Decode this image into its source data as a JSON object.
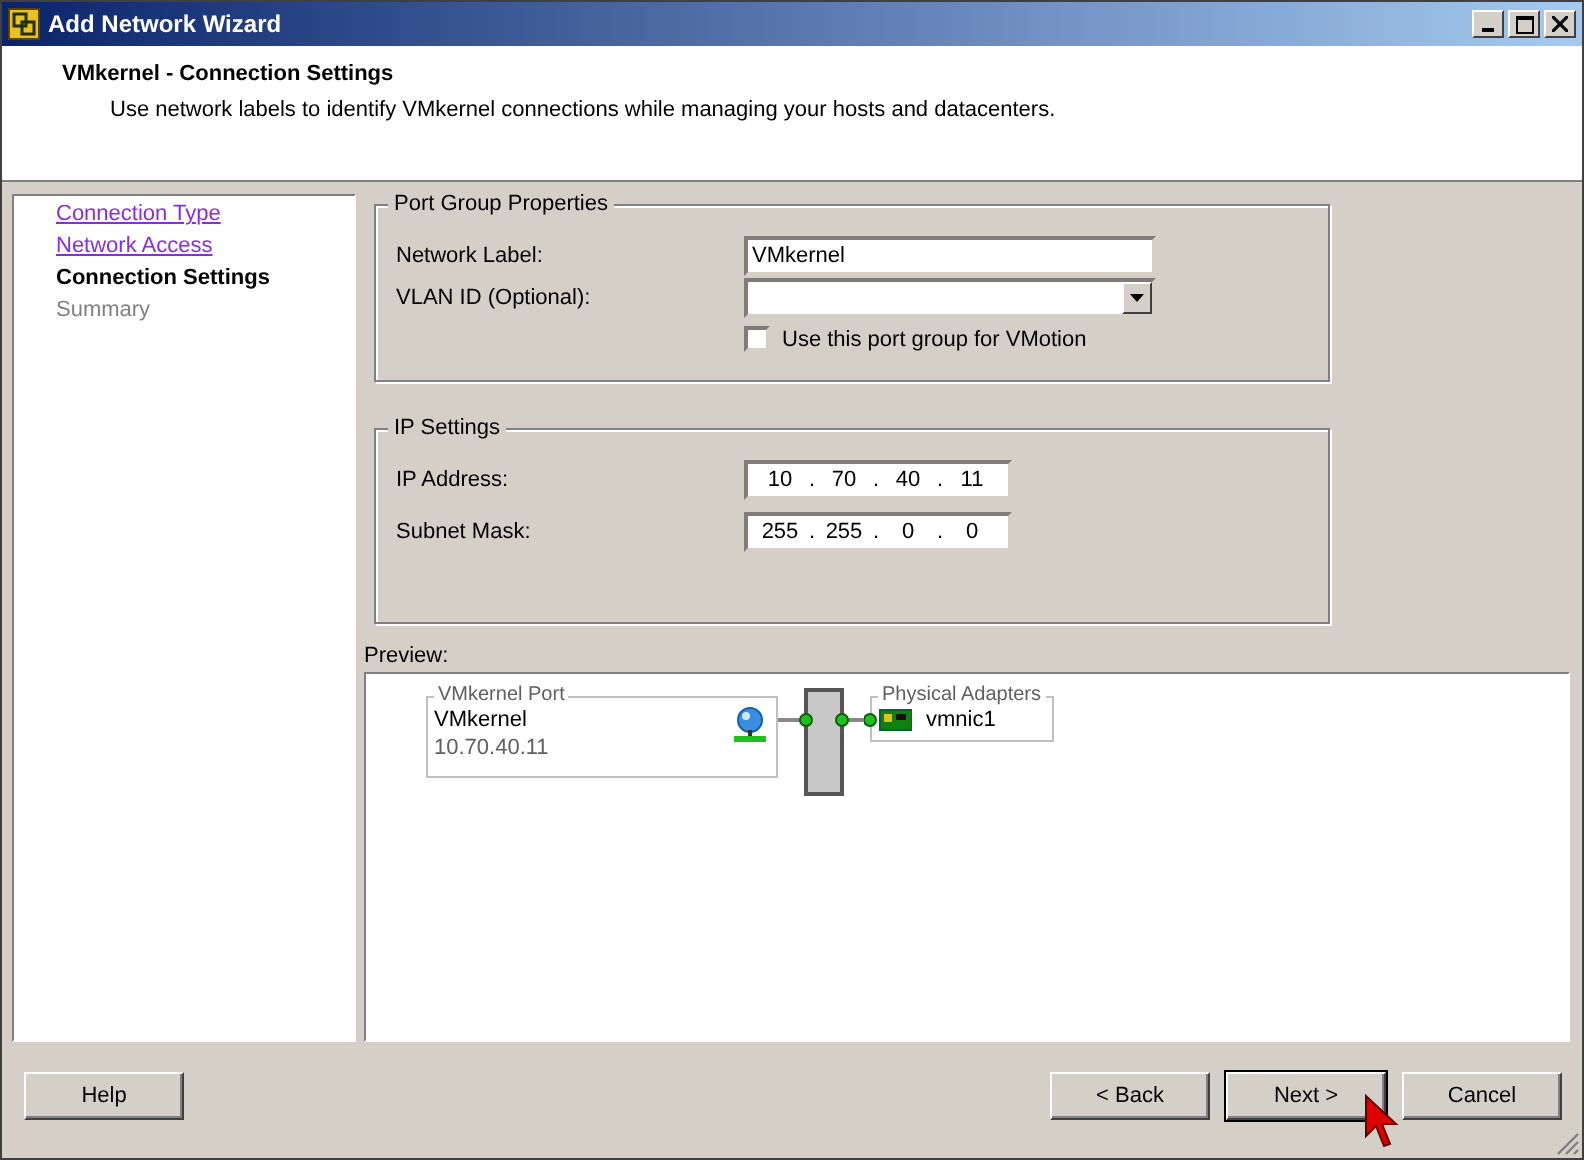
{
  "window": {
    "title": "Add Network Wizard"
  },
  "header": {
    "title": "VMkernel - Connection Settings",
    "subtitle": "Use network labels to identify VMkernel connections while managing your hosts and datacenters."
  },
  "steps": [
    {
      "label": "Connection Type",
      "kind": "visited"
    },
    {
      "label": "Network Access",
      "kind": "visited"
    },
    {
      "label": "Connection Settings",
      "kind": "current"
    },
    {
      "label": "Summary",
      "kind": "upcoming"
    }
  ],
  "port_group": {
    "legend": "Port Group Properties",
    "network_label": {
      "label": "Network Label:",
      "value": "VMkernel"
    },
    "vlan": {
      "label": "VLAN ID (Optional):"
    },
    "vmotion": {
      "label": "Use this port group for VMotion",
      "checked": false
    }
  },
  "ip_settings": {
    "legend": "IP Settings",
    "fields": [
      {
        "label": "IP Address:",
        "octets": [
          "10",
          "70",
          "40",
          "11"
        ],
        "separators": [
          ".",
          ".",
          "."
        ]
      },
      {
        "label": "Subnet Mask:",
        "octets": [
          "255",
          "255",
          "0",
          "0"
        ],
        "separators": [
          ".",
          ".",
          "."
        ]
      }
    ]
  },
  "preview": {
    "label": "Preview:",
    "port": {
      "legend": "VMkernel Port",
      "name": "VMkernel",
      "ip": "10.70.40.11"
    },
    "adapters": {
      "legend": "Physical Adapters",
      "items": [
        "vmnic1"
      ]
    }
  },
  "buttons": {
    "help": "Help",
    "back": "< Back",
    "next": "Next >",
    "cancel": "Cancel"
  }
}
